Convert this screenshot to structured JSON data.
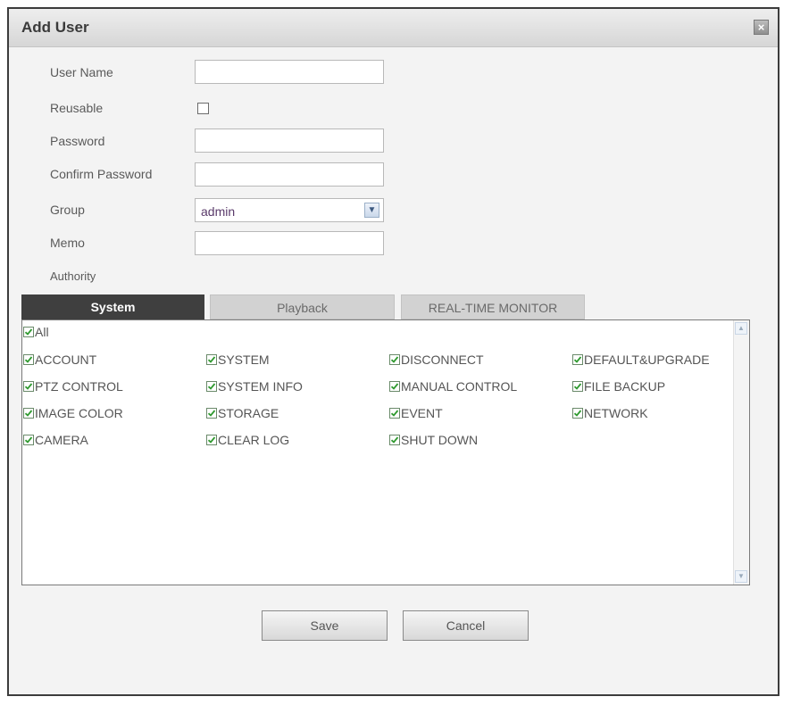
{
  "dialog": {
    "title": "Add User",
    "close_icon": "close-icon",
    "close_glyph": "×"
  },
  "form": {
    "user_name_label": "User Name",
    "user_name_value": "",
    "reusable_label": "Reusable",
    "reusable_checked": false,
    "password_label": "Password",
    "password_value": "",
    "confirm_password_label": "Confirm Password",
    "confirm_password_value": "",
    "group_label": "Group",
    "group_value": "admin",
    "memo_label": "Memo",
    "memo_value": "",
    "authority_label": "Authority"
  },
  "tabs": [
    {
      "label": "System",
      "active": true
    },
    {
      "label": "Playback",
      "active": false
    },
    {
      "label": "REAL-TIME MONITOR",
      "active": false
    }
  ],
  "permissions": {
    "all": {
      "label": "All",
      "checked": true
    },
    "items": [
      {
        "label": "ACCOUNT",
        "checked": true
      },
      {
        "label": "SYSTEM",
        "checked": true
      },
      {
        "label": "DISCONNECT",
        "checked": true
      },
      {
        "label": "DEFAULT&UPGRADE",
        "checked": true
      },
      {
        "label": "PTZ CONTROL",
        "checked": true
      },
      {
        "label": "SYSTEM INFO",
        "checked": true
      },
      {
        "label": "MANUAL CONTROL",
        "checked": true
      },
      {
        "label": "FILE BACKUP",
        "checked": true
      },
      {
        "label": "IMAGE COLOR",
        "checked": true
      },
      {
        "label": "STORAGE",
        "checked": true
      },
      {
        "label": "EVENT",
        "checked": true
      },
      {
        "label": "NETWORK",
        "checked": true
      },
      {
        "label": "CAMERA",
        "checked": true
      },
      {
        "label": "CLEAR LOG",
        "checked": true
      },
      {
        "label": "SHUT DOWN",
        "checked": true
      }
    ]
  },
  "buttons": {
    "save_label": "Save",
    "cancel_label": "Cancel"
  },
  "colors": {
    "checkmark": "#2f9a2f",
    "active_tab": "#3f3f3f"
  }
}
